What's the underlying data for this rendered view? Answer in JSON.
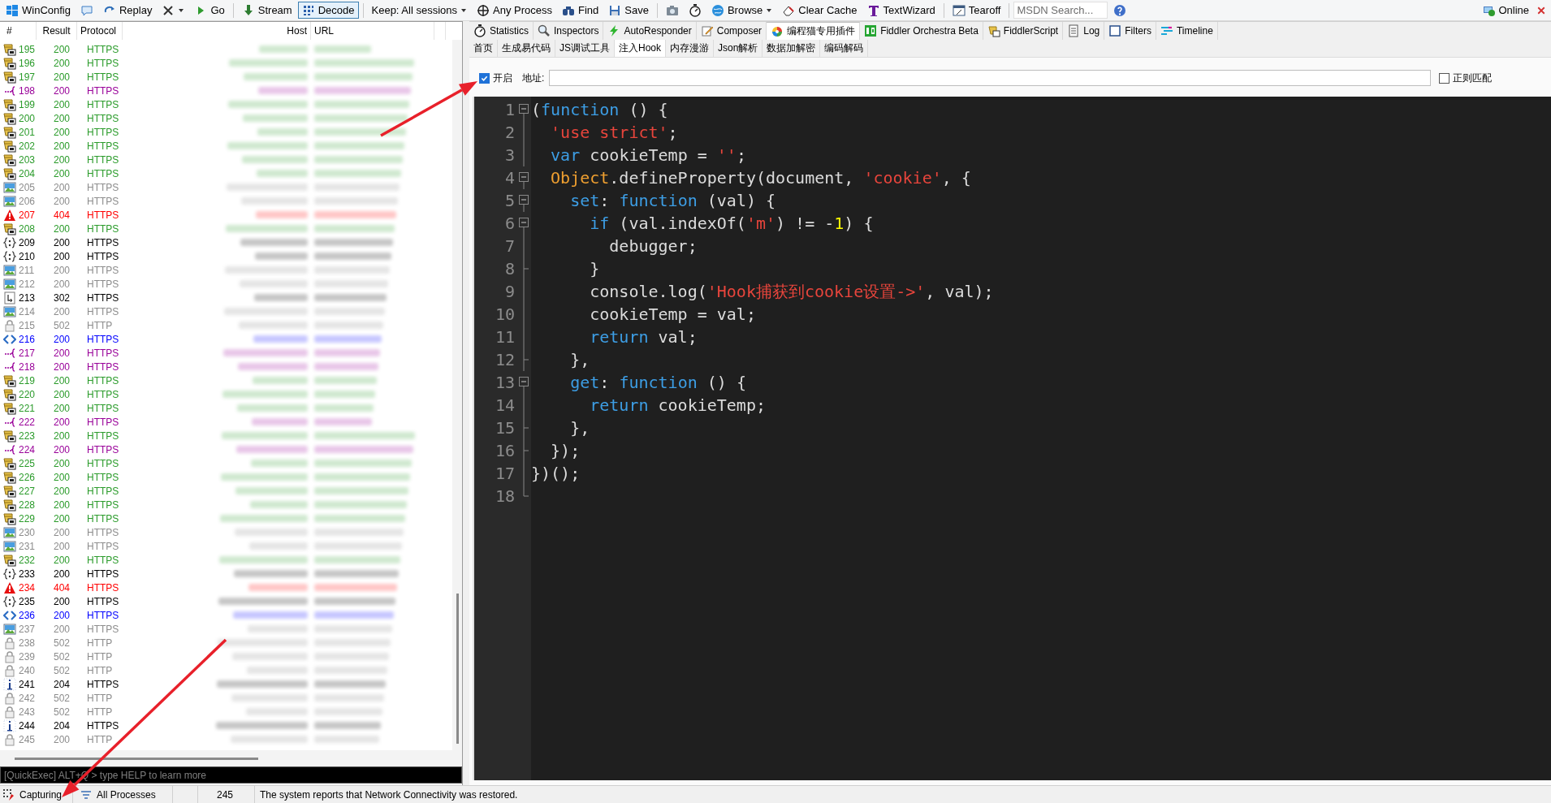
{
  "toolbar": {
    "items": [
      {
        "kind": "button",
        "label": "WinConfig"
      },
      {
        "kind": "icon"
      },
      {
        "kind": "button",
        "label": "Replay"
      },
      {
        "kind": "dropdown"
      },
      {
        "kind": "button",
        "label": "Go"
      },
      {
        "kind": "separator"
      },
      {
        "kind": "toggle",
        "label": "Stream",
        "pressed": false
      },
      {
        "kind": "toggle",
        "label": "Decode",
        "pressed": true
      },
      {
        "kind": "separator"
      },
      {
        "kind": "dropdown",
        "label": "Keep: All sessions"
      },
      {
        "kind": "button",
        "label": "Any Process"
      },
      {
        "kind": "button",
        "label": "Find"
      },
      {
        "kind": "button",
        "label": "Save"
      },
      {
        "kind": "separator"
      },
      {
        "kind": "icon"
      },
      {
        "kind": "icon"
      },
      {
        "kind": "dropdown",
        "label": "Browse"
      },
      {
        "kind": "button",
        "label": "Clear Cache"
      },
      {
        "kind": "button",
        "label": "TextWizard"
      },
      {
        "kind": "separator"
      },
      {
        "kind": "button",
        "label": "Tearoff"
      },
      {
        "kind": "separator"
      },
      {
        "kind": "search",
        "placeholder": "MSDN Search..."
      },
      {
        "kind": "icon"
      }
    ],
    "online": {
      "label": "Online"
    }
  },
  "sessions": {
    "columns": [
      "#",
      "Result",
      "Protocol",
      "Host",
      "URL"
    ],
    "rows": [
      {
        "num": "195",
        "result": "200",
        "protocol": "HTTPS",
        "kind": "js",
        "color": "#2a9b2a"
      },
      {
        "num": "196",
        "result": "200",
        "protocol": "HTTPS",
        "kind": "js",
        "color": "#2a9b2a"
      },
      {
        "num": "197",
        "result": "200",
        "protocol": "HTTPS",
        "kind": "js",
        "color": "#2a9b2a"
      },
      {
        "num": "198",
        "result": "200",
        "protocol": "HTTPS",
        "kind": "css",
        "color": "#990099"
      },
      {
        "num": "199",
        "result": "200",
        "protocol": "HTTPS",
        "kind": "js",
        "color": "#2a9b2a"
      },
      {
        "num": "200",
        "result": "200",
        "protocol": "HTTPS",
        "kind": "js",
        "color": "#2a9b2a"
      },
      {
        "num": "201",
        "result": "200",
        "protocol": "HTTPS",
        "kind": "js",
        "color": "#2a9b2a"
      },
      {
        "num": "202",
        "result": "200",
        "protocol": "HTTPS",
        "kind": "js",
        "color": "#2a9b2a"
      },
      {
        "num": "203",
        "result": "200",
        "protocol": "HTTPS",
        "kind": "js",
        "color": "#2a9b2a"
      },
      {
        "num": "204",
        "result": "200",
        "protocol": "HTTPS",
        "kind": "js",
        "color": "#2a9b2a"
      },
      {
        "num": "205",
        "result": "200",
        "protocol": "HTTPS",
        "kind": "image",
        "color": "#8c8c8c"
      },
      {
        "num": "206",
        "result": "200",
        "protocol": "HTTPS",
        "kind": "image",
        "color": "#8c8c8c"
      },
      {
        "num": "207",
        "result": "404",
        "protocol": "HTTPS",
        "kind": "error",
        "color": "#ff0000"
      },
      {
        "num": "208",
        "result": "200",
        "protocol": "HTTPS",
        "kind": "js",
        "color": "#2a9b2a"
      },
      {
        "num": "209",
        "result": "200",
        "protocol": "HTTPS",
        "kind": "json",
        "color": "#000000"
      },
      {
        "num": "210",
        "result": "200",
        "protocol": "HTTPS",
        "kind": "json",
        "color": "#000000"
      },
      {
        "num": "211",
        "result": "200",
        "protocol": "HTTPS",
        "kind": "image",
        "color": "#8c8c8c"
      },
      {
        "num": "212",
        "result": "200",
        "protocol": "HTTPS",
        "kind": "image",
        "color": "#8c8c8c"
      },
      {
        "num": "213",
        "result": "302",
        "protocol": "HTTPS",
        "kind": "redirect",
        "color": "#000000"
      },
      {
        "num": "214",
        "result": "200",
        "protocol": "HTTPS",
        "kind": "image",
        "color": "#8c8c8c"
      },
      {
        "num": "215",
        "result": "502",
        "protocol": "HTTP",
        "kind": "lock",
        "color": "#8c8c8c"
      },
      {
        "num": "216",
        "result": "200",
        "protocol": "HTTPS",
        "kind": "html",
        "color": "#0000ff"
      },
      {
        "num": "217",
        "result": "200",
        "protocol": "HTTPS",
        "kind": "css",
        "color": "#990099"
      },
      {
        "num": "218",
        "result": "200",
        "protocol": "HTTPS",
        "kind": "css",
        "color": "#990099"
      },
      {
        "num": "219",
        "result": "200",
        "protocol": "HTTPS",
        "kind": "js",
        "color": "#2a9b2a"
      },
      {
        "num": "220",
        "result": "200",
        "protocol": "HTTPS",
        "kind": "js",
        "color": "#2a9b2a"
      },
      {
        "num": "221",
        "result": "200",
        "protocol": "HTTPS",
        "kind": "js",
        "color": "#2a9b2a"
      },
      {
        "num": "222",
        "result": "200",
        "protocol": "HTTPS",
        "kind": "css",
        "color": "#990099"
      },
      {
        "num": "223",
        "result": "200",
        "protocol": "HTTPS",
        "kind": "js",
        "color": "#2a9b2a"
      },
      {
        "num": "224",
        "result": "200",
        "protocol": "HTTPS",
        "kind": "css",
        "color": "#990099"
      },
      {
        "num": "225",
        "result": "200",
        "protocol": "HTTPS",
        "kind": "js",
        "color": "#2a9b2a"
      },
      {
        "num": "226",
        "result": "200",
        "protocol": "HTTPS",
        "kind": "js",
        "color": "#2a9b2a"
      },
      {
        "num": "227",
        "result": "200",
        "protocol": "HTTPS",
        "kind": "js",
        "color": "#2a9b2a"
      },
      {
        "num": "228",
        "result": "200",
        "protocol": "HTTPS",
        "kind": "js",
        "color": "#2a9b2a"
      },
      {
        "num": "229",
        "result": "200",
        "protocol": "HTTPS",
        "kind": "js",
        "color": "#2a9b2a"
      },
      {
        "num": "230",
        "result": "200",
        "protocol": "HTTPS",
        "kind": "image",
        "color": "#8c8c8c"
      },
      {
        "num": "231",
        "result": "200",
        "protocol": "HTTPS",
        "kind": "image",
        "color": "#8c8c8c"
      },
      {
        "num": "232",
        "result": "200",
        "protocol": "HTTPS",
        "kind": "js",
        "color": "#2a9b2a"
      },
      {
        "num": "233",
        "result": "200",
        "protocol": "HTTPS",
        "kind": "json",
        "color": "#000000"
      },
      {
        "num": "234",
        "result": "404",
        "protocol": "HTTPS",
        "kind": "error",
        "color": "#ff0000"
      },
      {
        "num": "235",
        "result": "200",
        "protocol": "HTTPS",
        "kind": "json",
        "color": "#000000"
      },
      {
        "num": "236",
        "result": "200",
        "protocol": "HTTPS",
        "kind": "html",
        "color": "#0000ff"
      },
      {
        "num": "237",
        "result": "200",
        "protocol": "HTTPS",
        "kind": "image",
        "color": "#8c8c8c"
      },
      {
        "num": "238",
        "result": "502",
        "protocol": "HTTP",
        "kind": "lock",
        "color": "#8c8c8c"
      },
      {
        "num": "239",
        "result": "502",
        "protocol": "HTTP",
        "kind": "lock",
        "color": "#8c8c8c"
      },
      {
        "num": "240",
        "result": "502",
        "protocol": "HTTP",
        "kind": "lock",
        "color": "#8c8c8c"
      },
      {
        "num": "241",
        "result": "204",
        "protocol": "HTTPS",
        "kind": "info",
        "color": "#000000"
      },
      {
        "num": "242",
        "result": "502",
        "protocol": "HTTP",
        "kind": "lock",
        "color": "#8c8c8c"
      },
      {
        "num": "243",
        "result": "502",
        "protocol": "HTTP",
        "kind": "lock",
        "color": "#8c8c8c"
      },
      {
        "num": "244",
        "result": "204",
        "protocol": "HTTPS",
        "kind": "info",
        "color": "#000000"
      },
      {
        "num": "245",
        "result": "200",
        "protocol": "HTTP",
        "kind": "lock",
        "color": "#8c8c8c"
      }
    ]
  },
  "quickexec": {
    "placeholder": "[QuickExec] ALT+Q > type HELP to learn more"
  },
  "tabs": [
    {
      "label": "Statistics",
      "selected": false
    },
    {
      "label": "Inspectors",
      "selected": false
    },
    {
      "label": "AutoResponder",
      "selected": false
    },
    {
      "label": "Composer",
      "selected": false
    },
    {
      "label": "编程猫专用插件",
      "selected": true
    },
    {
      "label": "Fiddler Orchestra Beta",
      "selected": false
    },
    {
      "label": "FiddlerScript",
      "selected": false
    },
    {
      "label": "Log",
      "selected": false
    },
    {
      "label": "Filters",
      "selected": false
    },
    {
      "label": "Timeline",
      "selected": false
    }
  ],
  "subtabs": [
    {
      "label": "首页",
      "selected": false
    },
    {
      "label": "生成易代码",
      "selected": false
    },
    {
      "label": "JS调试工具",
      "selected": false
    },
    {
      "label": "注入Hook",
      "selected": true
    },
    {
      "label": "内存漫游",
      "selected": false
    },
    {
      "label": "Json解析",
      "selected": false
    },
    {
      "label": "数据加解密",
      "selected": false
    },
    {
      "label": "编码解码",
      "selected": false
    }
  ],
  "hook": {
    "enable": {
      "label": "开启",
      "checked": true
    },
    "address_label": "地址:",
    "regex": {
      "label": "正则匹配",
      "checked": false
    }
  },
  "editor": {
    "lines": [
      {
        "number": "1",
        "kind": "open",
        "tokens": [
          {
            "text": "(",
            "kind": "plain"
          },
          {
            "text": "function",
            "kind": "keyword"
          },
          {
            "text": " () {",
            "kind": "plain"
          }
        ]
      },
      {
        "number": "2",
        "kind": "body",
        "tokens": [
          {
            "text": "  'use strict'",
            "kind": "string"
          },
          {
            "text": ";",
            "kind": "plain"
          }
        ]
      },
      {
        "number": "3",
        "kind": "body",
        "tokens": [
          {
            "text": "  var",
            "kind": "keyword"
          },
          {
            "text": " cookieTemp = ",
            "kind": "plain"
          },
          {
            "text": "''",
            "kind": "string"
          },
          {
            "text": ";",
            "kind": "plain"
          }
        ]
      },
      {
        "number": "4",
        "kind": "open",
        "tokens": [
          {
            "text": "  Object",
            "kind": "object"
          },
          {
            "text": ".defineProperty(document, ",
            "kind": "plain"
          },
          {
            "text": "'cookie'",
            "kind": "string"
          },
          {
            "text": ", {",
            "kind": "plain"
          }
        ]
      },
      {
        "number": "5",
        "kind": "open",
        "tokens": [
          {
            "text": "    set",
            "kind": "keyword"
          },
          {
            "text": ": ",
            "kind": "plain"
          },
          {
            "text": "function",
            "kind": "keyword"
          },
          {
            "text": " (val) {",
            "kind": "plain"
          }
        ]
      },
      {
        "number": "6",
        "kind": "open",
        "tokens": [
          {
            "text": "      if",
            "kind": "keyword"
          },
          {
            "text": " (val.indexOf(",
            "kind": "plain"
          },
          {
            "text": "'m'",
            "kind": "string"
          },
          {
            "text": ") != -",
            "kind": "plain"
          },
          {
            "text": "1",
            "kind": "number"
          },
          {
            "text": ") {",
            "kind": "plain"
          }
        ]
      },
      {
        "number": "7",
        "kind": "body",
        "tokens": [
          {
            "text": "        debugger;",
            "kind": "plain"
          }
        ]
      },
      {
        "number": "8",
        "kind": "close",
        "tokens": [
          {
            "text": "      }",
            "kind": "plain"
          }
        ]
      },
      {
        "number": "9",
        "kind": "body",
        "tokens": [
          {
            "text": "      console.log(",
            "kind": "plain"
          },
          {
            "text": "'Hook捕获到cookie设置->'",
            "kind": "string"
          },
          {
            "text": ", val);",
            "kind": "plain"
          }
        ]
      },
      {
        "number": "10",
        "kind": "body",
        "tokens": [
          {
            "text": "      cookieTemp = val;",
            "kind": "plain"
          }
        ]
      },
      {
        "number": "11",
        "kind": "body",
        "tokens": [
          {
            "text": "      return",
            "kind": "keyword"
          },
          {
            "text": " val;",
            "kind": "plain"
          }
        ]
      },
      {
        "number": "12",
        "kind": "close",
        "tokens": [
          {
            "text": "    },",
            "kind": "plain"
          }
        ]
      },
      {
        "number": "13",
        "kind": "open",
        "tokens": [
          {
            "text": "    get",
            "kind": "keyword"
          },
          {
            "text": ": ",
            "kind": "plain"
          },
          {
            "text": "function",
            "kind": "keyword"
          },
          {
            "text": " () {",
            "kind": "plain"
          }
        ]
      },
      {
        "number": "14",
        "kind": "body",
        "tokens": [
          {
            "text": "      return",
            "kind": "keyword"
          },
          {
            "text": " cookieTemp;",
            "kind": "plain"
          }
        ]
      },
      {
        "number": "15",
        "kind": "close",
        "tokens": [
          {
            "text": "    },",
            "kind": "plain"
          }
        ]
      },
      {
        "number": "16",
        "kind": "close",
        "tokens": [
          {
            "text": "  });",
            "kind": "plain"
          }
        ]
      },
      {
        "number": "17",
        "kind": "body",
        "tokens": [
          {
            "text": "})();",
            "kind": "plain"
          }
        ]
      },
      {
        "number": "18",
        "kind": "close"
      }
    ]
  },
  "status_bar": {
    "capture": "Capturing",
    "process_filter": "All Processes",
    "count": "245",
    "message": "The system reports that Network Connectivity was restored."
  },
  "annotations": [
    {
      "kind": "arrow"
    },
    {
      "kind": "arrow"
    }
  ]
}
